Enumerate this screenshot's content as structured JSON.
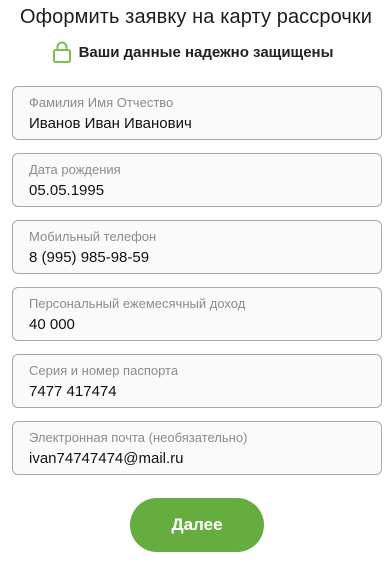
{
  "header": {
    "title": "Оформить заявку на карту рассрочки"
  },
  "security": {
    "icon": "lock-icon",
    "text": "Ваши данные надежно защищены",
    "icon_color": "#7cbf4b"
  },
  "form": {
    "fields": [
      {
        "label": "Фамилия Имя Отчество",
        "value": "Иванов Иван Иванович"
      },
      {
        "label": "Дата рождения",
        "value": "05.05.1995"
      },
      {
        "label": "Мобильный телефон",
        "value": "8 (995) 985-98-59"
      },
      {
        "label": "Персональный ежемесячный доход",
        "value": "40 000"
      },
      {
        "label": "Серия и номер паспорта",
        "value": "7477 417474"
      },
      {
        "label": "Электронная почта (необязательно)",
        "value": "ivan74747474@mail.ru"
      }
    ],
    "submit_label": "Далее",
    "accent_color": "#66ad3f"
  }
}
